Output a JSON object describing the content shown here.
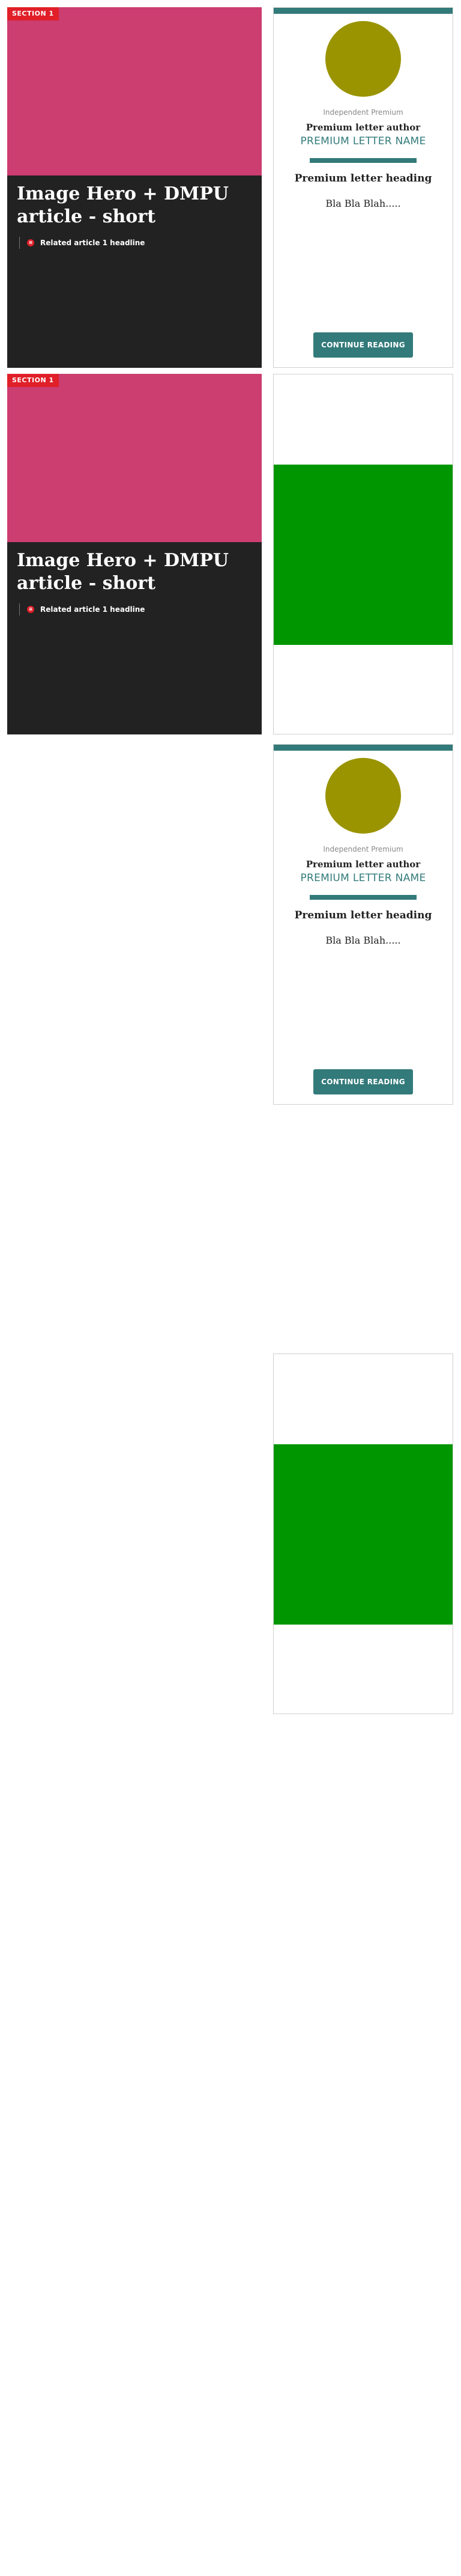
{
  "colors": {
    "hero_image": "#cc3d70",
    "hero_panel": "#222222",
    "section_tag": "#e01f28",
    "accent_teal": "#337a7a",
    "avatar": "#9a9400",
    "ad_fill": "#009600"
  },
  "hero_cards": [
    {
      "section_label": "SECTION 1",
      "title": "Image Hero + DMPU article - short",
      "related_icon": "dot-icon",
      "related_headline": "Related article 1 headline"
    },
    {
      "section_label": "SECTION 1",
      "title": "Image Hero + DMPU article - short",
      "related_icon": "dot-icon",
      "related_headline": "Related article 1 headline"
    }
  ],
  "letter_cards": [
    {
      "kicker": "Independent Premium",
      "author": "Premium letter author",
      "name": "",
      "heading": "Premium letter heading",
      "body": "Bla Bla Blah.....",
      "cta": "CONTINUE READING"
    },
    {
      "kicker": "Independent Premium",
      "author": "Premium letter author",
      "name": "PREMIUM LETTER NAME",
      "heading": "Premium letter heading",
      "body": "Bla Bla Blah.....",
      "cta": "CONTINUE READING"
    }
  ]
}
